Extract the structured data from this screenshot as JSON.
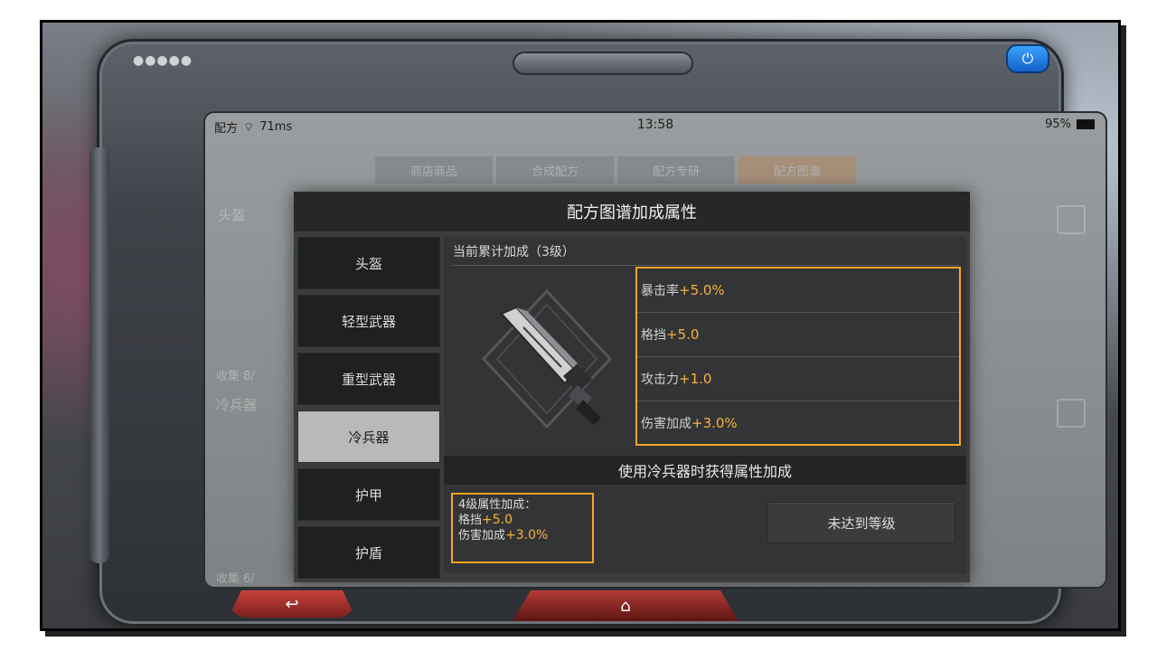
{
  "status": {
    "app": "配方",
    "ping": "71ms",
    "time": "13:58",
    "battery": "95%"
  },
  "background": {
    "tabs": [
      "商店商品",
      "合成配方",
      "配方专研",
      "配方图谱"
    ],
    "label_helmet": "头盔",
    "label_melee": "冷兵器",
    "label_collect_1": "收集 8/",
    "label_collect_2": "收集 6/"
  },
  "dialog": {
    "title": "配方图谱加成属性",
    "categories": [
      {
        "label": "头盔",
        "active": false
      },
      {
        "label": "轻型武器",
        "active": false
      },
      {
        "label": "重型武器",
        "active": false
      },
      {
        "label": "冷兵器",
        "active": true
      },
      {
        "label": "护甲",
        "active": false
      },
      {
        "label": "护盾",
        "active": false
      }
    ],
    "current_label": "当前累计加成（3级）",
    "stats": [
      {
        "name": "暴击率",
        "value": "+5.0%"
      },
      {
        "name": "格挡",
        "value": "+5.0"
      },
      {
        "name": "攻击力",
        "value": "+1.0"
      },
      {
        "name": "伤害加成",
        "value": "+3.0%"
      }
    ],
    "use_banner": "使用冷兵器时获得属性加成",
    "next_level": {
      "title": "4级属性加成：",
      "stats": [
        {
          "name": "格挡",
          "value": "+5.0"
        },
        {
          "name": "伤害加成",
          "value": "+3.0%"
        }
      ]
    },
    "level_button": "未达到等级"
  },
  "colors": {
    "accent": "#f5a623",
    "value": "#f7b23b",
    "active_category": "#b8b9ba",
    "power_button": "#1e7fe6",
    "nav_button": "#b33a35"
  }
}
